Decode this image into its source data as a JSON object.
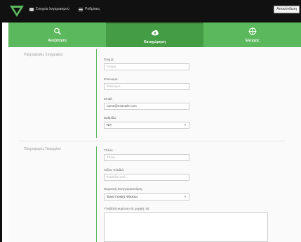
{
  "topbar": {
    "account_label": "Στοιχεία λογαριασμού",
    "settings_label": "Ρυθμίσεις",
    "logout_label": "Αποσύνδεση"
  },
  "tabs": [
    {
      "label": "Αναζήτηση",
      "icon": "search-icon",
      "active": false
    },
    {
      "label": "Καταχώρηση",
      "icon": "cloud-upload-icon",
      "active": true
    },
    {
      "label": "Έλεγχος",
      "icon": "crosshair-icon",
      "active": false
    }
  ],
  "sections": {
    "contact": {
      "title": "Πληροφορίες Συγγραφέα",
      "name_label": "Όνομα:",
      "name_placeholder": "Όνομα",
      "surname_label": "Επώνυμο:",
      "surname_placeholder": "Επώνυμο",
      "email_label": "Email:",
      "email_value": "name@example.com",
      "rank_label": "Βαθμίδα:",
      "rank_value": "N/A"
    },
    "item": {
      "title": "Πληροφορίες Τεκμηρίου",
      "title_label": "Τίτλος:",
      "title_placeholder": "Τίτλος",
      "keywords_label": "Λέξεις Κλειδιά:",
      "keywords_placeholder": "Επιλέξτε από...",
      "category_label": "Θεματική Κατηγοριοποίηση:",
      "category_value": "Έργα Γενικής Φύσεως",
      "upload_label": "Υποβολή κειμένου σε μορφή .txt:"
    }
  },
  "colors": {
    "green": "#5cb85c",
    "green_active": "#449d44",
    "topbar": "#111111"
  }
}
